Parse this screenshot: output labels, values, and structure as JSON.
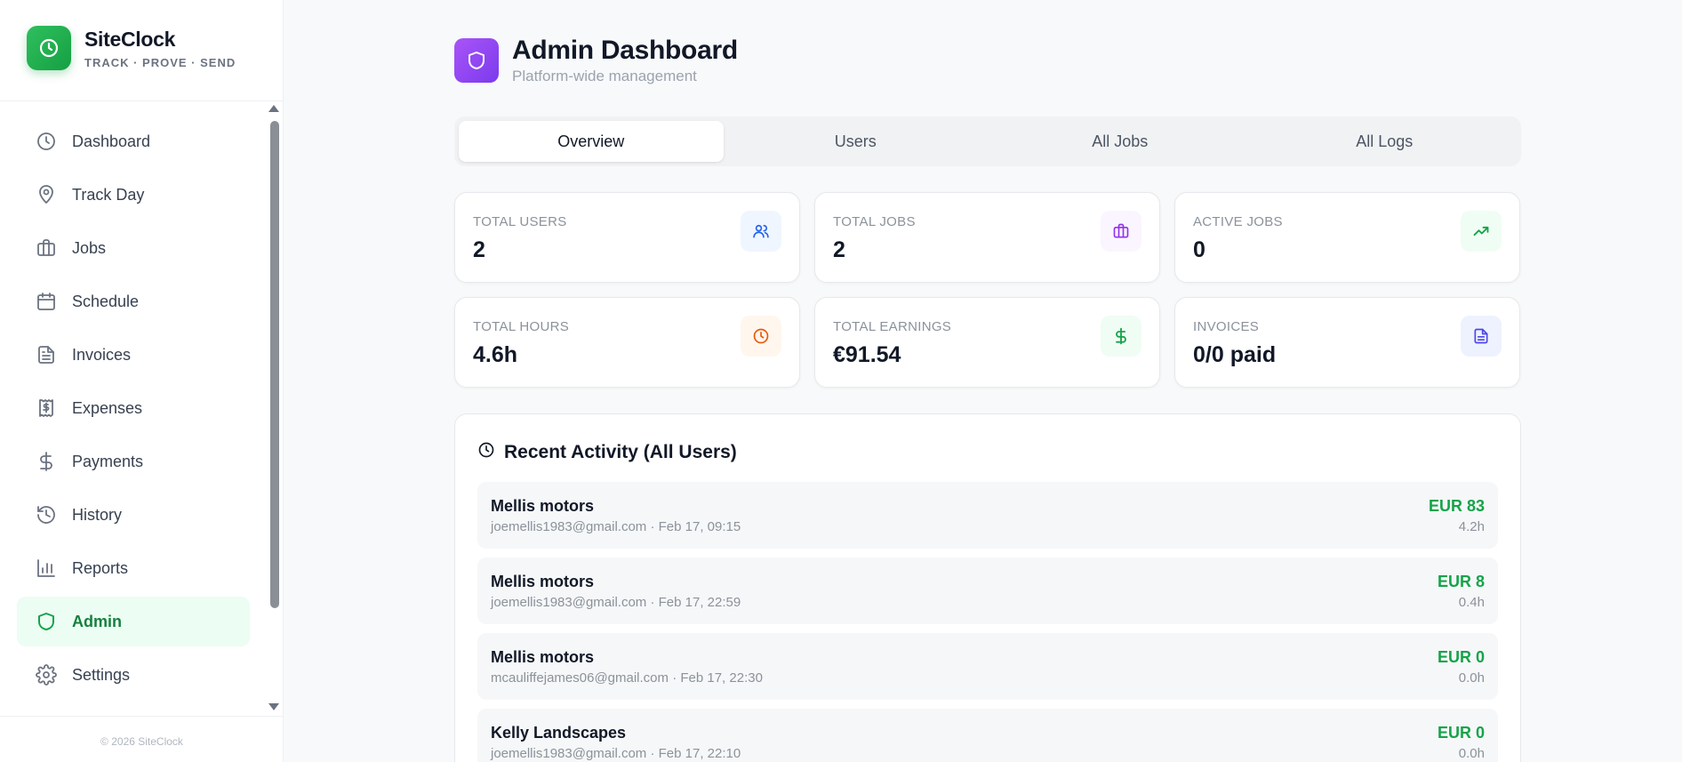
{
  "brand": {
    "name": "SiteClock",
    "tagline": "TRACK · PROVE · SEND"
  },
  "sidebar": {
    "items": [
      {
        "label": "Dashboard",
        "icon": "clock-icon"
      },
      {
        "label": "Track Day",
        "icon": "map-pin-icon"
      },
      {
        "label": "Jobs",
        "icon": "briefcase-icon"
      },
      {
        "label": "Schedule",
        "icon": "calendar-icon"
      },
      {
        "label": "Invoices",
        "icon": "file-text-icon"
      },
      {
        "label": "Expenses",
        "icon": "receipt-icon"
      },
      {
        "label": "Payments",
        "icon": "dollar-icon"
      },
      {
        "label": "History",
        "icon": "history-icon"
      },
      {
        "label": "Reports",
        "icon": "bar-chart-icon"
      },
      {
        "label": "Admin",
        "icon": "shield-icon",
        "active": true
      },
      {
        "label": "Settings",
        "icon": "gear-icon"
      }
    ],
    "copyright": "© 2026 SiteClock"
  },
  "header": {
    "title": "Admin Dashboard",
    "subtitle": "Platform-wide management"
  },
  "tabs": [
    "Overview",
    "Users",
    "All Jobs",
    "All Logs"
  ],
  "active_tab": "Overview",
  "stats": [
    {
      "label": "TOTAL USERS",
      "value": "2",
      "icon": "users-icon",
      "color": "#2563eb",
      "bg": "#eff6ff"
    },
    {
      "label": "TOTAL JOBS",
      "value": "2",
      "icon": "briefcase-icon",
      "color": "#9333ea",
      "bg": "#faf5ff"
    },
    {
      "label": "ACTIVE JOBS",
      "value": "0",
      "icon": "trending-up-icon",
      "color": "#16a34a",
      "bg": "#f0fdf4"
    },
    {
      "label": "TOTAL HOURS",
      "value": "4.6h",
      "icon": "clock-icon",
      "color": "#ea580c",
      "bg": "#fff7ed"
    },
    {
      "label": "TOTAL EARNINGS",
      "value": "€91.54",
      "icon": "dollar-icon",
      "color": "#16a34a",
      "bg": "#f0fdf4"
    },
    {
      "label": "INVOICES",
      "value": "0/0 paid",
      "icon": "file-text-icon",
      "color": "#4f46e5",
      "bg": "#eef2ff"
    }
  ],
  "activity": {
    "title": "Recent Activity (All Users)",
    "rows": [
      {
        "name": "Mellis motors",
        "meta": "joemellis1983@gmail.com · Feb 17, 09:15",
        "amount": "EUR 83",
        "hours": "4.2h"
      },
      {
        "name": "Mellis motors",
        "meta": "joemellis1983@gmail.com · Feb 17, 22:59",
        "amount": "EUR 8",
        "hours": "0.4h"
      },
      {
        "name": "Mellis motors",
        "meta": "mcauliffejames06@gmail.com · Feb 17, 22:30",
        "amount": "EUR 0",
        "hours": "0.0h"
      },
      {
        "name": "Kelly Landscapes",
        "meta": "joemellis1983@gmail.com · Feb 17, 22:10",
        "amount": "EUR 0",
        "hours": "0.0h"
      }
    ]
  },
  "colors": {
    "brand_green": "#16a34a",
    "admin_purple": "#8b5cf6"
  }
}
